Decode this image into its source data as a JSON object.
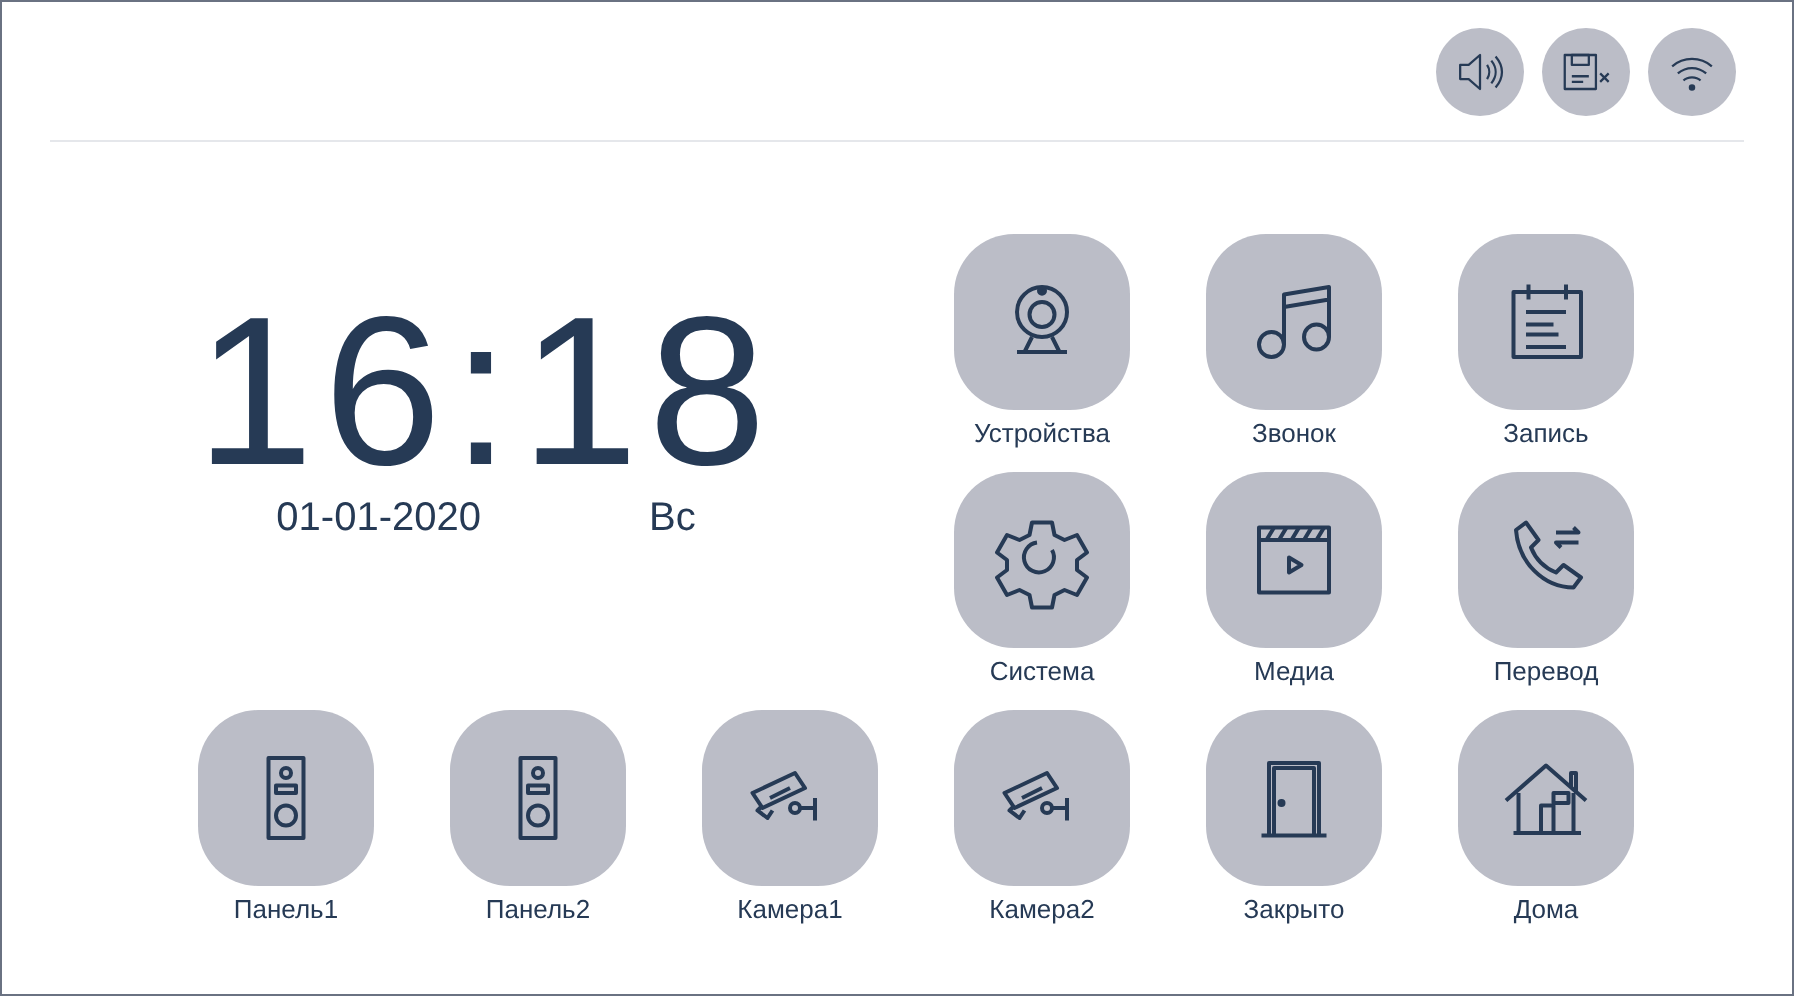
{
  "status_icons": [
    {
      "kind": "speaker"
    },
    {
      "kind": "card-off"
    },
    {
      "kind": "wifi"
    }
  ],
  "clock": {
    "time": "16:18",
    "date": "01-01-2020",
    "weekday": "Вс"
  },
  "tiles": [
    {
      "label": "Устройства",
      "kind": "webcam"
    },
    {
      "label": "Звонок",
      "kind": "music"
    },
    {
      "label": "Запись",
      "kind": "calendar"
    },
    {
      "label": "Система",
      "kind": "gear"
    },
    {
      "label": "Медиа",
      "kind": "film"
    },
    {
      "label": "Перевод",
      "kind": "transfer"
    },
    {
      "label": "Панель1",
      "kind": "doorbell"
    },
    {
      "label": "Панель2",
      "kind": "doorbell"
    },
    {
      "label": "Камера1",
      "kind": "cctv"
    },
    {
      "label": "Камера2",
      "kind": "cctv"
    },
    {
      "label": "Закрыто",
      "kind": "door"
    },
    {
      "label": "Дома",
      "kind": "house"
    }
  ]
}
